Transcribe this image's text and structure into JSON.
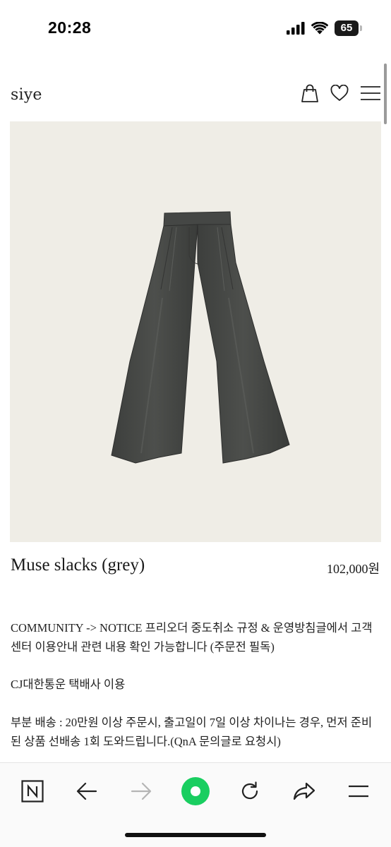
{
  "status_bar": {
    "time": "20:28",
    "battery_level": "65"
  },
  "header": {
    "logo": "siye",
    "icons": [
      "shopping-bag-icon",
      "heart-icon",
      "menu-icon"
    ]
  },
  "product": {
    "image_alt": "grey wide-leg slacks",
    "name": "Muse slacks (grey)",
    "price": "102,000원"
  },
  "description": {
    "notice": "COMMUNITY -> NOTICE  프리오더 중도취소 규정 & 운영방침글에서 고객센터 이용안내 관련 내용 확인 가능합니다 (주문전 필독)",
    "courier": "CJ대한통운 택배사 이용",
    "partial_shipping": "부분 배송 : 20만원 이상 주문시, 출고일이 7일 이상 차이나는 경우, 먼저 준비된 상품 선배송 1회 도와드립니다.(QnA 문의글로 요청시)"
  },
  "browser_toolbar": {
    "icons": [
      "naver-n-icon",
      "back-arrow-icon",
      "forward-arrow-icon",
      "green-dot-icon",
      "refresh-icon",
      "share-icon",
      "menu-icon"
    ],
    "accent": "#19ce60"
  }
}
